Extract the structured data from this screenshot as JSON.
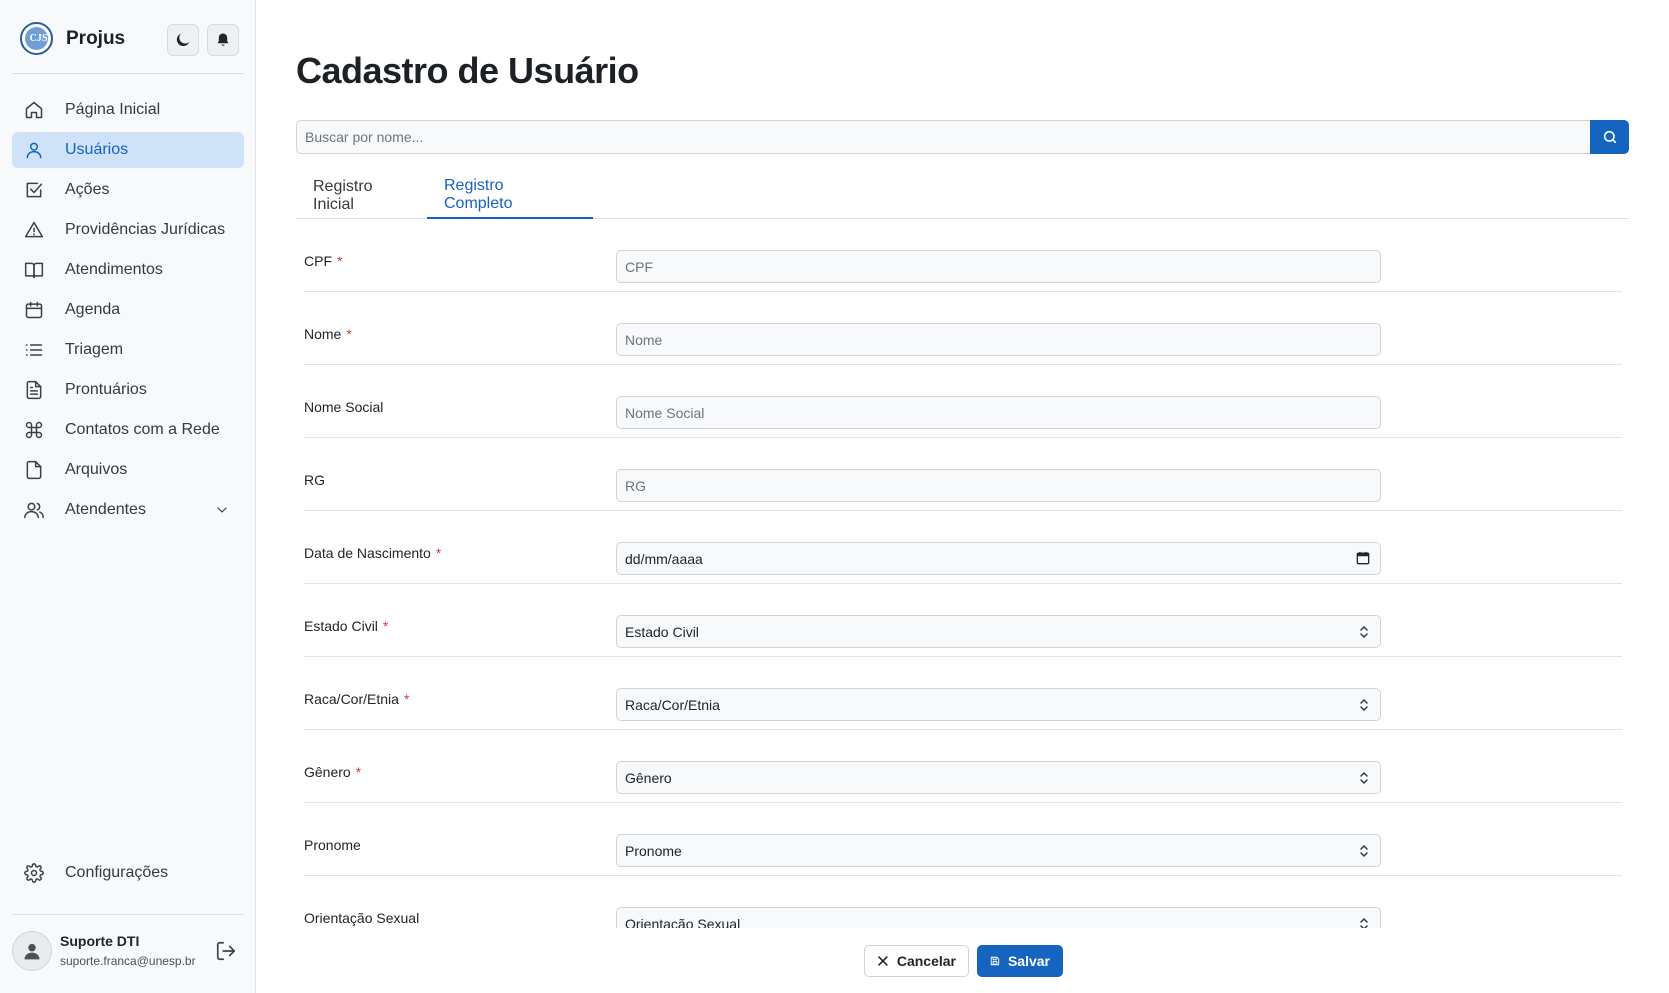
{
  "sidebar": {
    "logo_text": "CJS",
    "app_title": "Projus",
    "nav": [
      {
        "label": "Página Inicial",
        "icon": "home-icon",
        "active": false
      },
      {
        "label": "Usuários",
        "icon": "user-icon",
        "active": true
      },
      {
        "label": "Ações",
        "icon": "checkbox-icon",
        "active": false
      },
      {
        "label": "Providências Jurídicas",
        "icon": "alert-triangle-icon",
        "active": false
      },
      {
        "label": "Atendimentos",
        "icon": "book-icon",
        "active": false
      },
      {
        "label": "Agenda",
        "icon": "calendar-icon",
        "active": false
      },
      {
        "label": "Triagem",
        "icon": "list-icon",
        "active": false
      },
      {
        "label": "Prontuários",
        "icon": "file-text-icon",
        "active": false
      },
      {
        "label": "Contatos com a Rede",
        "icon": "command-icon",
        "active": false
      },
      {
        "label": "Arquivos",
        "icon": "file-icon",
        "active": false
      },
      {
        "label": "Atendentes",
        "icon": "users-icon",
        "active": false
      }
    ],
    "settings_label": "Configurações",
    "user": {
      "name": "Suporte DTI",
      "email": "suporte.franca@unesp.br"
    }
  },
  "main": {
    "title": "Cadastro de Usuário",
    "search": {
      "placeholder": "Buscar por nome..."
    },
    "tabs": [
      {
        "label": "Registro Inicial",
        "active": false
      },
      {
        "label": "Registro Completo",
        "active": true
      }
    ],
    "form": {
      "rows": [
        {
          "label": "CPF",
          "required": true,
          "type": "text",
          "placeholder": "CPF"
        },
        {
          "label": "Nome",
          "required": true,
          "type": "text",
          "placeholder": "Nome"
        },
        {
          "label": "Nome Social",
          "required": false,
          "type": "text",
          "placeholder": "Nome Social"
        },
        {
          "label": "RG",
          "required": false,
          "type": "text",
          "placeholder": "RG"
        },
        {
          "label": "Data de Nascimento",
          "required": true,
          "type": "date",
          "value": "dd/mm/aaaa"
        },
        {
          "label": "Estado Civil",
          "required": true,
          "type": "select",
          "value": "Estado Civil"
        },
        {
          "label": "Raca/Cor/Etnia",
          "required": true,
          "type": "select",
          "value": "Raca/Cor/Etnia"
        },
        {
          "label": "Gênero",
          "required": true,
          "type": "select",
          "value": "Gênero"
        },
        {
          "label": "Pronome",
          "required": false,
          "type": "select",
          "value": "Pronome"
        },
        {
          "label": "Orientação Sexual",
          "required": false,
          "type": "select",
          "value": "Orientação Sexual"
        }
      ],
      "required_mark": "*"
    },
    "actions": {
      "cancel_label": "Cancelar",
      "save_label": "Salvar"
    }
  },
  "colors": {
    "primary": "#1565c0",
    "active_bg": "#cfe2f8",
    "required": "#d63a3a"
  }
}
